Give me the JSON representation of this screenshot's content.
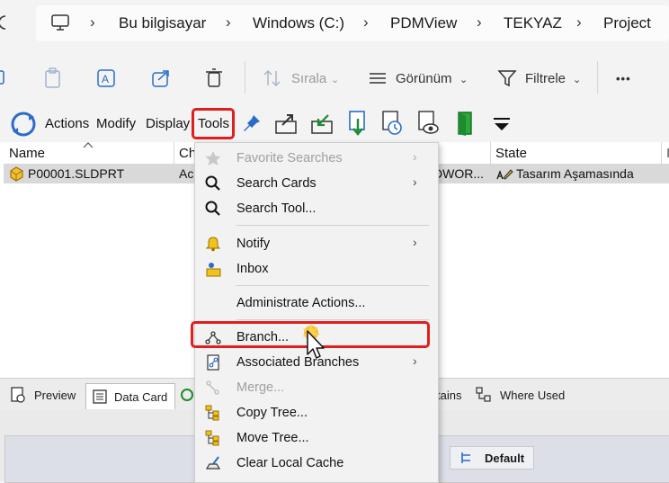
{
  "address_bar": {
    "crumbs": [
      "Bu bilgisayar",
      "Windows (C:)",
      "PDMView",
      "TEKYAZ",
      "Project"
    ]
  },
  "command_bar": {
    "sort_label": "Sırala",
    "view_label": "Görünüm",
    "filter_label": "Filtrele",
    "more_label": "•••"
  },
  "pdm_menu": {
    "actions": "Actions",
    "modify": "Modify",
    "display": "Display",
    "tools": "Tools"
  },
  "file_list": {
    "columns": {
      "name": "Name",
      "checked": "Ch",
      "state": "State"
    },
    "rows": [
      {
        "name": "P00001.SLDPRT",
        "checked": "Ac",
        "path_part": "DWOR...",
        "state": "Tasarım Aşamasında"
      }
    ]
  },
  "tools_menu": {
    "items": [
      {
        "label": "Favorite Searches",
        "disabled": true,
        "submenu": true,
        "icon": "star-icon"
      },
      {
        "label": "Search Cards",
        "disabled": false,
        "submenu": true,
        "icon": "search-icon"
      },
      {
        "label": "Search Tool...",
        "disabled": false,
        "submenu": false,
        "icon": "search-icon"
      },
      {
        "label": "Notify",
        "disabled": false,
        "submenu": true,
        "icon": "bell-icon"
      },
      {
        "label": "Inbox",
        "disabled": false,
        "submenu": false,
        "icon": "inbox-icon"
      },
      {
        "label": "Administrate Actions...",
        "disabled": false,
        "submenu": false,
        "icon": ""
      },
      {
        "label": "Branch...",
        "disabled": false,
        "submenu": false,
        "icon": "branch-icon"
      },
      {
        "label": "Associated Branches",
        "disabled": false,
        "submenu": true,
        "icon": "associated-branches-icon"
      },
      {
        "label": "Merge...",
        "disabled": true,
        "submenu": false,
        "icon": "merge-icon"
      },
      {
        "label": "Copy Tree...",
        "disabled": false,
        "submenu": false,
        "icon": "copy-tree-icon"
      },
      {
        "label": "Move Tree...",
        "disabled": false,
        "submenu": false,
        "icon": "move-tree-icon"
      },
      {
        "label": "Clear Local Cache",
        "disabled": false,
        "submenu": false,
        "icon": "clear-cache-icon"
      }
    ]
  },
  "bottom_tabs": {
    "preview": "Preview",
    "data_card": "Data Card",
    "contains": "tains",
    "where_used": "Where Used"
  },
  "lower_panel": {
    "config": "Default"
  },
  "colors": {
    "highlight": "#e01e1e",
    "selected_row": "#d9d9d9",
    "menu_bg": "#f2f2f2"
  }
}
